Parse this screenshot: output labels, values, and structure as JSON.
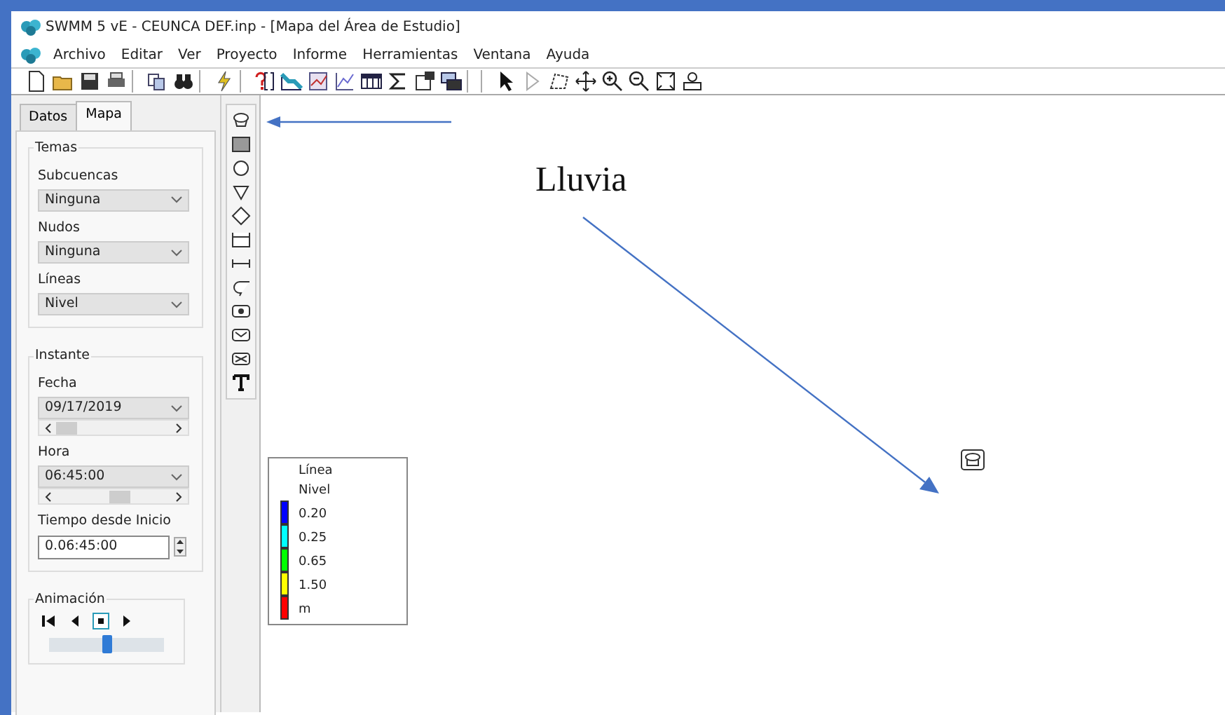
{
  "window": {
    "title": "SWMM 5 vE - CEUNCA DEF.inp - [Mapa del Área de Estudio]"
  },
  "menu": [
    "Archivo",
    "Editar",
    "Ver",
    "Proyecto",
    "Informe",
    "Herramientas",
    "Ventana",
    "Ayuda"
  ],
  "tabs": [
    {
      "label": "Datos",
      "selected": false
    },
    {
      "label": "Mapa",
      "selected": true
    }
  ],
  "themes": {
    "legend": "Temas",
    "fields": [
      {
        "label": "Subcuencas",
        "value": "Ninguna"
      },
      {
        "label": "Nudos",
        "value": "Ninguna"
      },
      {
        "label": "Líneas",
        "value": "Nivel"
      }
    ]
  },
  "instant": {
    "legend": "Instante",
    "date": {
      "label": "Fecha",
      "value": "09/17/2019"
    },
    "time": {
      "label": "Hora",
      "value": "06:45:00"
    },
    "elapsed": {
      "label": "Tiempo desde Inicio",
      "value": "0.06:45:00"
    }
  },
  "animation": {
    "legend": "Animación",
    "level": 0.5
  },
  "map_legend": {
    "title": "Línea",
    "subtitle": "Nivel",
    "entries": [
      {
        "color": "#0000ff",
        "label": "0.20"
      },
      {
        "color": "#00ffff",
        "label": "0.25"
      },
      {
        "color": "#00ff00",
        "label": "0.65"
      },
      {
        "color": "#ffff00",
        "label": "1.50"
      },
      {
        "color": "#ff0000",
        "label": "m"
      }
    ]
  },
  "annotation": {
    "text": "Lluvia"
  }
}
